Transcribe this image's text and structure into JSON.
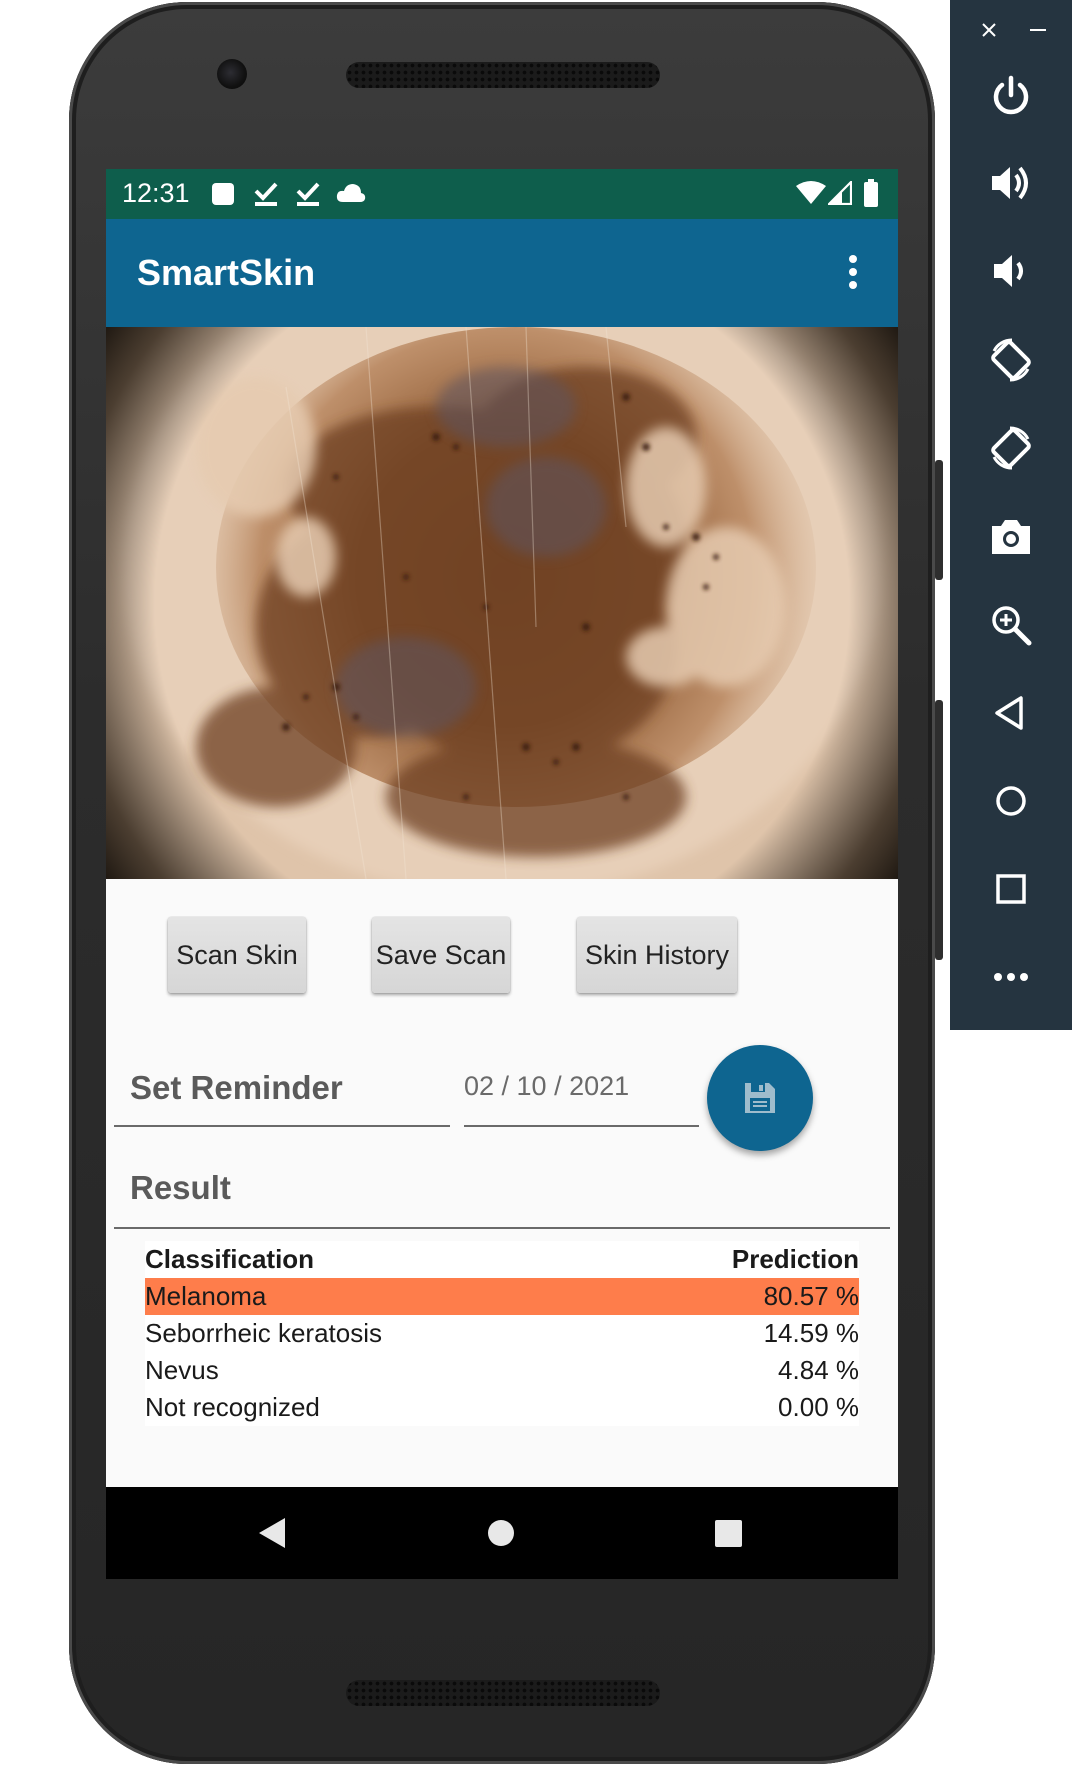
{
  "status_bar": {
    "time": "12:31",
    "left_icons": [
      "square-notification-icon",
      "download-done-icon",
      "download-done-icon",
      "cloud-icon"
    ],
    "right_icons": [
      "wifi-icon",
      "signal-icon",
      "battery-icon"
    ],
    "bg_color": "#0e5e4c"
  },
  "app_bar": {
    "title": "SmartSkin",
    "menu_icon": "more-vert-icon",
    "bg_color": "#0e6590"
  },
  "image": {
    "subject": "dermoscopy skin lesion"
  },
  "buttons": {
    "scan": "Scan Skin",
    "save": "Save Scan",
    "history": "Skin History"
  },
  "reminder": {
    "label": "Set Reminder",
    "date": "02 / 10 / 2021",
    "save_icon": "floppy-disk-icon"
  },
  "result": {
    "label": "Result",
    "headers": {
      "classification": "Classification",
      "prediction": "Prediction"
    },
    "rows": [
      {
        "name": "Melanoma",
        "value": "80.57 %",
        "highlight": true
      },
      {
        "name": "Seborrheic keratosis",
        "value": "14.59 %",
        "highlight": false
      },
      {
        "name": "Nevus",
        "value": "4.84 %",
        "highlight": false
      },
      {
        "name": "Not recognized",
        "value": "0.00 %",
        "highlight": false
      }
    ],
    "highlight_color": "#fe7d4b"
  },
  "nav_bar": {
    "icons": [
      "back-icon",
      "home-icon",
      "recents-icon"
    ]
  },
  "emulator_toolbar": {
    "window_controls": [
      "close-icon",
      "minimize-icon"
    ],
    "items": [
      "power-icon",
      "volume-up-icon",
      "volume-down-icon",
      "rotate-left-icon",
      "rotate-right-icon",
      "camera-icon",
      "zoom-icon",
      "back-icon",
      "home-icon",
      "overview-icon",
      "more-icon"
    ],
    "bg_color": "#253440"
  }
}
